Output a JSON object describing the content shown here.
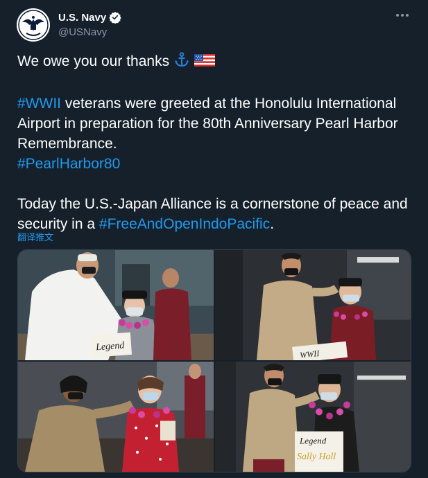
{
  "author": {
    "display_name": "U.S. Navy",
    "handle": "@USNavy",
    "verified": true,
    "avatar_icon": "navy-eagle-emblem-icon"
  },
  "menu": {
    "icon": "more-options-icon"
  },
  "tweet": {
    "line1": "We owe you our thanks",
    "emoji1": "anchor-emoji",
    "emoji2": "us-flag-emoji",
    "p2_tag": "#WWII",
    "p2_text": " veterans were greeted at the Honolulu International Airport in preparation for the 80th Anniversary Pearl Harbor Remembrance.",
    "p2_tag2": "#PearlHarbor80",
    "p3_text": "Today the U.S.-Japan Alliance is a cornerstone of peace and security in a ",
    "p3_tag": "#FreeAndOpenIndoPacific",
    "p3_end": "."
  },
  "translate_link": "翻译推文",
  "media": {
    "photo1_sign": "Legend",
    "photo2_sign": "WWII",
    "photo4_sign_line1": "Legend",
    "photo4_sign_line2": "Sally Hall"
  },
  "colors": {
    "background": "#15202b",
    "text": "#ffffff",
    "secondary": "#8b98a5",
    "link": "#1d9bf0"
  }
}
